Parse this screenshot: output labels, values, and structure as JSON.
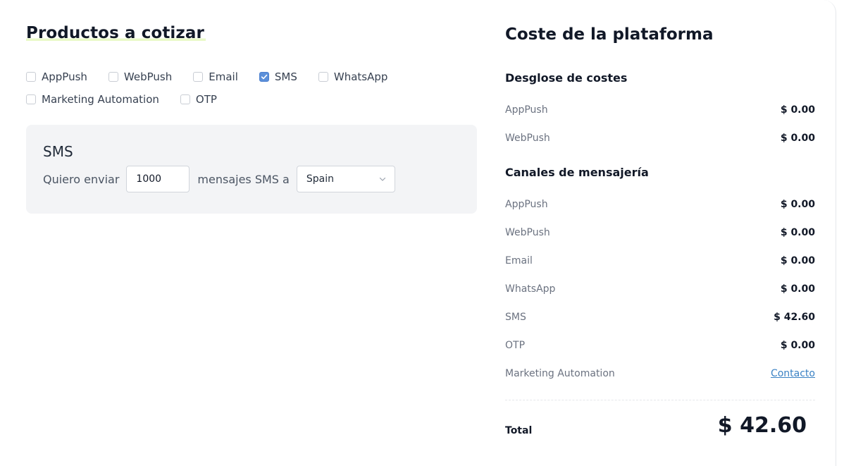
{
  "products": {
    "title": "Productos a cotizar",
    "row1": [
      {
        "label": "AppPush",
        "checked": false
      },
      {
        "label": "WebPush",
        "checked": false
      },
      {
        "label": "Email",
        "checked": false
      },
      {
        "label": "SMS",
        "checked": true
      },
      {
        "label": "WhatsApp",
        "checked": false
      }
    ],
    "row2": [
      {
        "label": "Marketing Automation",
        "checked": false
      },
      {
        "label": "OTP",
        "checked": false
      }
    ]
  },
  "sms": {
    "title": "SMS",
    "prefix": "Quiero enviar",
    "quantity": "1000",
    "middle": "mensajes SMS a",
    "country": "Spain"
  },
  "costs": {
    "title": "Coste de la plataforma",
    "breakdown_title": "Desglose de costes",
    "breakdown": [
      {
        "label": "AppPush",
        "value": "$ 0.00"
      },
      {
        "label": "WebPush",
        "value": "$ 0.00"
      }
    ],
    "channels_title": "Canales de mensajería",
    "channels": [
      {
        "label": "AppPush",
        "value": "$ 0.00"
      },
      {
        "label": "WebPush",
        "value": "$ 0.00"
      },
      {
        "label": "Email",
        "value": "$ 0.00"
      },
      {
        "label": "WhatsApp",
        "value": "$ 0.00"
      },
      {
        "label": "SMS",
        "value": "$ 42.60"
      },
      {
        "label": "OTP",
        "value": "$ 0.00"
      }
    ],
    "marketing_label": "Marketing Automation",
    "marketing_link": "Contacto",
    "total_label": "Total",
    "total_value": "$ 42.60"
  },
  "colors": {
    "checkbox_checked": "#5b8fd9",
    "link": "#3b82c4",
    "title_highlight": "#e9f9c8"
  }
}
